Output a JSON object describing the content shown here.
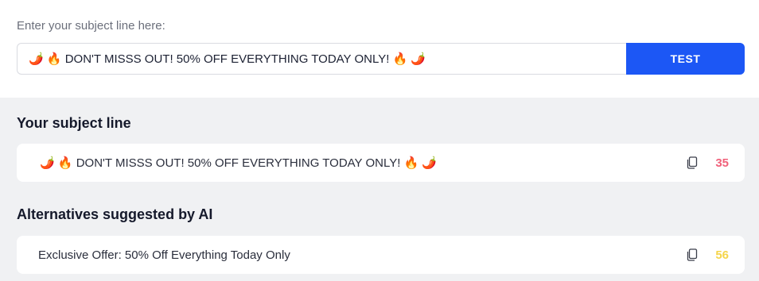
{
  "input": {
    "label": "Enter your subject line here:",
    "value": "🌶️ 🔥 DON'T MISSS OUT! 50% OFF EVERYTHING TODAY ONLY! 🔥 🌶️",
    "button_label": "TEST"
  },
  "results": {
    "title": "Your subject line",
    "subject": "🌶️ 🔥 DON'T MISSS OUT! 50% OFF EVERYTHING TODAY ONLY! 🔥 🌶️",
    "score": "35",
    "score_color": "#f0607a"
  },
  "alternatives": {
    "title": "Alternatives suggested by AI",
    "items": [
      {
        "text": "Exclusive Offer: 50% Off Everything Today Only",
        "score": "56",
        "score_color": "#f5d54a"
      }
    ]
  },
  "colors": {
    "accent": "#1c57f5",
    "background": "#f0f1f3"
  },
  "icons": {
    "copy": "copy-icon"
  }
}
